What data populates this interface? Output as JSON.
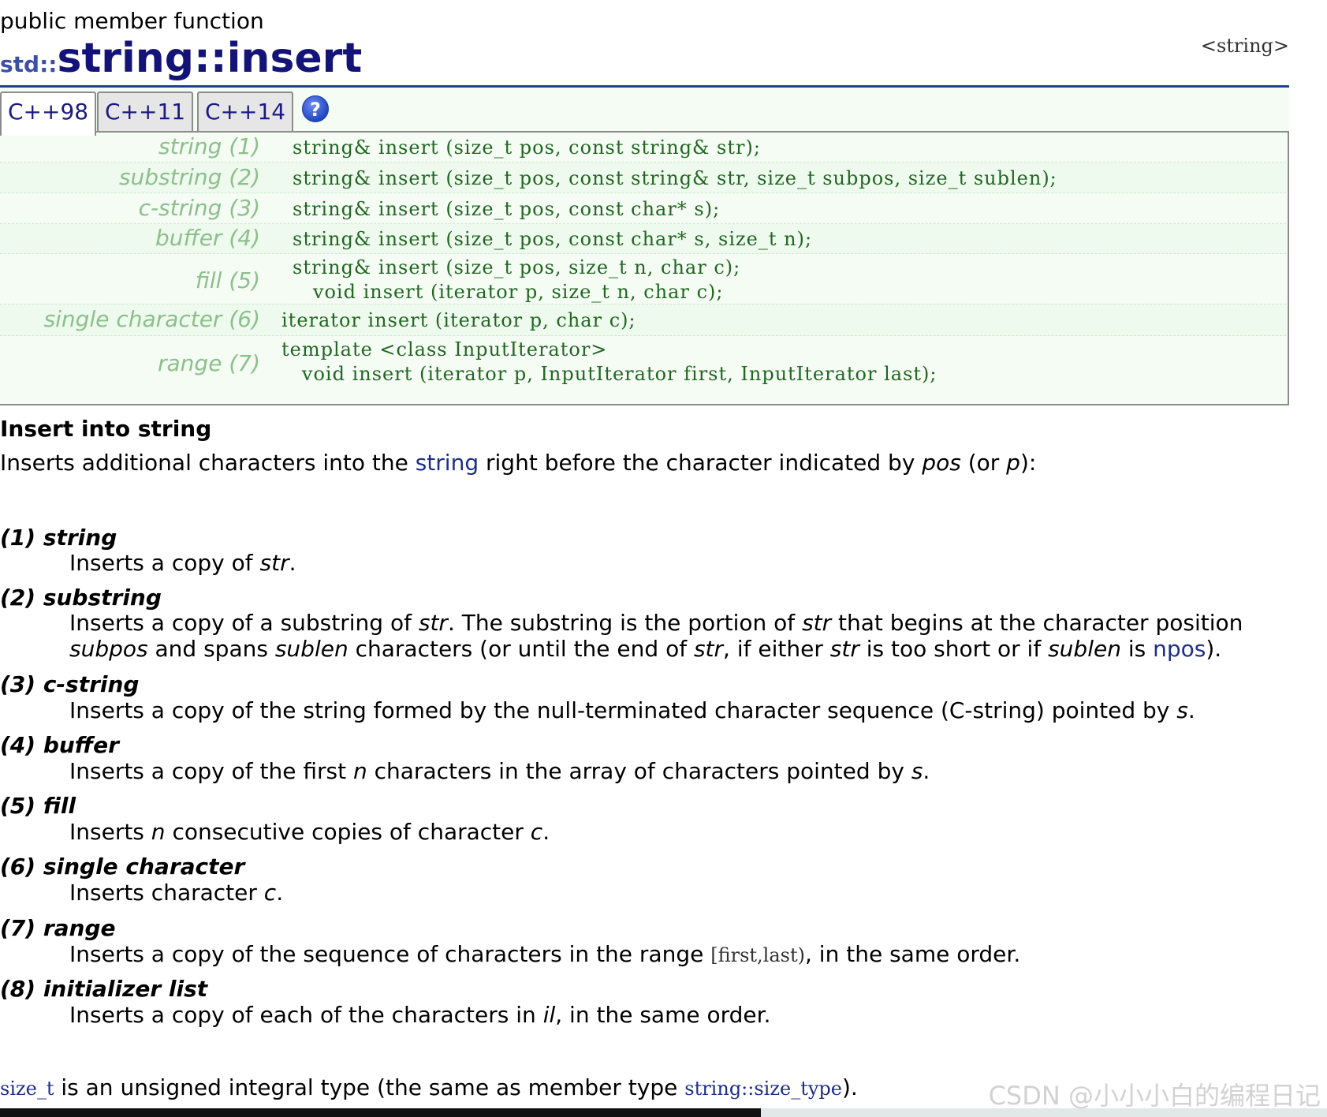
{
  "page": {
    "kind": "public member function",
    "namespace": "std::",
    "name": "string::insert",
    "header_file": "<string>"
  },
  "tabs": [
    {
      "label": "C++98",
      "active": true
    },
    {
      "label": "C++11",
      "active": false
    },
    {
      "label": "C++14",
      "active": false
    }
  ],
  "help_icon": {
    "glyph": "?",
    "icon": "help-icon"
  },
  "declarations": [
    {
      "label": "string (1)",
      "lines": [
        "string& insert (size_t pos, const string& str);"
      ]
    },
    {
      "label": "substring (2)",
      "lines": [
        "string& insert (size_t pos, const string& str, size_t subpos, size_t sublen);"
      ]
    },
    {
      "label": "c-string (3)",
      "lines": [
        "string& insert (size_t pos, const char* s);"
      ]
    },
    {
      "label": "buffer (4)",
      "lines": [
        "string& insert (size_t pos, const char* s, size_t n);"
      ]
    },
    {
      "label": "fill (5)",
      "lines": [
        "string& insert (size_t pos, size_t n, char c);",
        "   void insert (iterator p, size_t n, char c);"
      ]
    },
    {
      "label": "single character (6)",
      "lines": [
        "iterator insert (iterator p, char c);"
      ]
    },
    {
      "label": "range (7)",
      "lines": [
        "template <class InputIterator>",
        "   void insert (iterator p, InputIterator first, InputIterator last);"
      ]
    }
  ],
  "description": {
    "heading": "Insert into string",
    "intro": {
      "before": "Inserts additional characters into the ",
      "link": "string",
      "middle": " right before the character indicated by ",
      "pos": "pos",
      "or": " (or ",
      "p": "p",
      "after": "):"
    }
  },
  "params": {
    "p1": {
      "term": "(1) string",
      "t1": "Inserts a copy of ",
      "str": "str",
      "t2": "."
    },
    "p2": {
      "term": "(2) substring",
      "l1_a": "Inserts a copy of a substring of ",
      "l1_str": "str",
      "l1_b": ". The substring is the portion of ",
      "l1_str2": "str",
      "l1_c": " that begins at the character position",
      "l2_subpos": "subpos",
      "l2_a": " and spans ",
      "l2_sublen": "sublen",
      "l2_b": " characters (or until the end of ",
      "l2_str": "str",
      "l2_c": ", if either ",
      "l2_str2": "str",
      "l2_d": " is too short or if ",
      "l2_sublen2": "sublen",
      "l2_e": " is ",
      "l2_npos": "npos",
      "l2_f": ")."
    },
    "p3": {
      "term": "(3) c-string",
      "t1": "Inserts a copy of the string formed by the null-terminated character sequence (C-string) pointed by ",
      "s": "s",
      "t2": "."
    },
    "p4": {
      "term": "(4) buffer",
      "t1": "Inserts a copy of the first ",
      "n": "n",
      "t2": " characters in the array of characters pointed by ",
      "s": "s",
      "t3": "."
    },
    "p5": {
      "term": "(5) fill",
      "t1": "Inserts ",
      "n": "n",
      "t2": " consecutive copies of character ",
      "c": "c",
      "t3": "."
    },
    "p6": {
      "term": "(6) single character",
      "t1": "Inserts character ",
      "c": "c",
      "t2": "."
    },
    "p7": {
      "term": "(7) range",
      "t1": "Inserts a copy of the sequence of characters in the range ",
      "range": "[first,last)",
      "t2": ", in the same order."
    },
    "p8": {
      "term": "(8) initializer list",
      "t1": "Inserts a copy of each of the characters in ",
      "il": "il",
      "t2": ", in the same order."
    }
  },
  "note": {
    "size_t": "size_t",
    "t1": " is an unsigned integral type (the same as member type ",
    "size_type": "string::size_type",
    "t2": ")."
  },
  "watermark": "CSDN @小小小白的编程日记"
}
